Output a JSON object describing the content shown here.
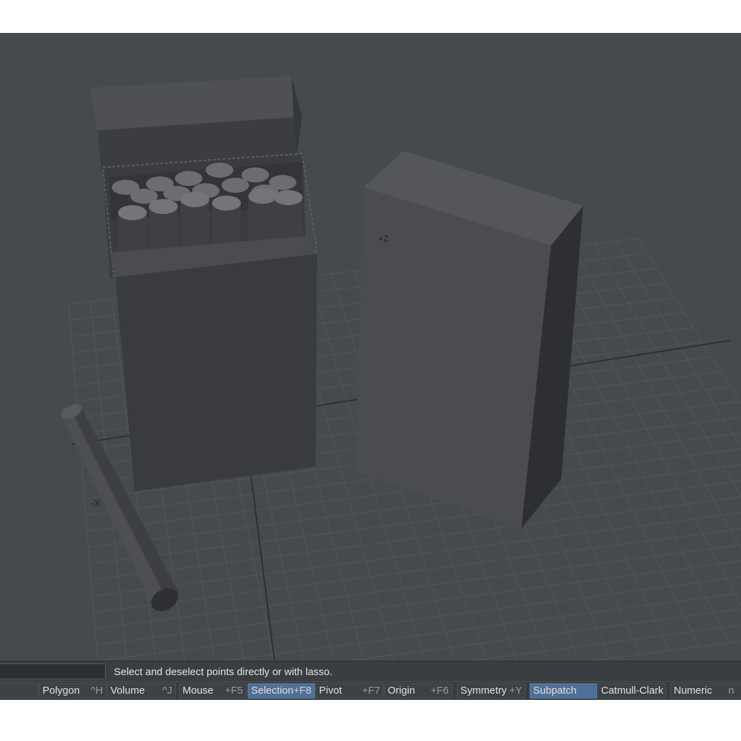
{
  "viewport": {
    "background": "#464a4f",
    "axis_labels": {
      "z": "+Z",
      "x": "-X"
    }
  },
  "status": {
    "message": "Select and deselect points directly or with lasso."
  },
  "toolbar": {
    "polygon": {
      "label": "Polygon",
      "key": "^H"
    },
    "volume": {
      "label": "Volume",
      "key": "^J"
    },
    "mouse": {
      "label": "Mouse",
      "key": "+F5"
    },
    "selection": {
      "label": "Selection",
      "key": "+F8",
      "active": true
    },
    "pivot": {
      "label": "Pivot",
      "key": "+F7"
    },
    "origin": {
      "label": "Origin",
      "key": "+F6"
    },
    "symmetry": {
      "label": "Symmetry",
      "key": "+Y"
    },
    "subpatch": {
      "label": "Subpatch",
      "active": true
    },
    "catmull": {
      "label": "Catmull-Clark"
    },
    "numeric": {
      "label": "Numeric",
      "key": "n"
    }
  },
  "colors": {
    "active_button": "#4e6f96",
    "grid_line": "#53575c"
  }
}
